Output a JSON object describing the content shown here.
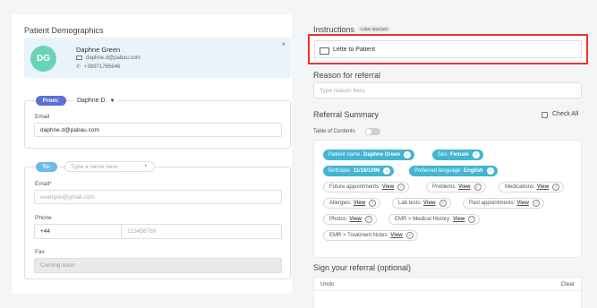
{
  "patient_demographics": {
    "title": "Patient Demographics",
    "avatar_initials": "DG",
    "name": "Daphne Green",
    "email": "daphne.d@pabau.com",
    "phone": "+38971765646",
    "close": "×"
  },
  "from": {
    "tag": "From:",
    "selected_user": "Daphne D.",
    "email_label": "Email",
    "email_value": "daphne.d@pabau.com"
  },
  "to": {
    "tag": "To:",
    "name_placeholder": "Type a name here",
    "required_mark": "*",
    "email_label": "Email",
    "email_placeholder": "example@gmail.com",
    "phone_label": "Phone",
    "phone_code": "+44",
    "phone_placeholder": "123456789",
    "fax_label": "Fax",
    "fax_value": "Coming soon"
  },
  "instructions": {
    "title": "Instructions",
    "badge": "Letter attached",
    "letter_label": "Lette to Patient"
  },
  "reason": {
    "title": "Reason for referral",
    "placeholder": "Type reason here"
  },
  "summary": {
    "title": "Referral Summary",
    "check_all": "Check All",
    "toc_label": "Table of Contents",
    "chips": [
      {
        "label": "Patient name:",
        "value": "Daphne Green",
        "active": true
      },
      {
        "label": "Sex:",
        "value": "Female",
        "active": true
      },
      {
        "label": "Birthdate:",
        "value": "11/18/1996",
        "active": true
      },
      {
        "label": "Preferred language:",
        "value": "English",
        "active": true
      },
      {
        "label": "Future appointments:",
        "value": "View",
        "active": false
      },
      {
        "label": "Problems:",
        "value": "View",
        "active": false
      },
      {
        "label": "Medications:",
        "value": "View",
        "active": false
      },
      {
        "label": "Allergies:",
        "value": "View",
        "active": false
      },
      {
        "label": "Lab tests:",
        "value": "View",
        "active": false
      },
      {
        "label": "Past appointments:",
        "value": "View",
        "active": false
      },
      {
        "label": "Photos:",
        "value": "View",
        "active": false
      },
      {
        "label": "EMR > Medical History:",
        "value": "View",
        "active": false
      },
      {
        "label": "EMR > Treatment Notes:",
        "value": "View",
        "active": false
      }
    ]
  },
  "signature": {
    "title": "Sign your referral (optional)",
    "undo": "Undo",
    "clear": "Clear"
  },
  "colors": {
    "accent_blue": "#42b5d2",
    "from_tag": "#5b6fd6",
    "to_tag": "#6fb9ea",
    "avatar": "#69d3b8",
    "highlight_border": "#e5362e"
  }
}
